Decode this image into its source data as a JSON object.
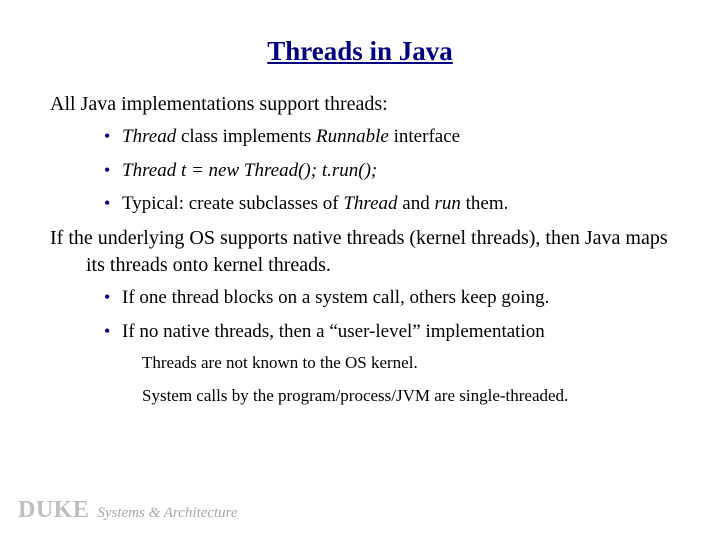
{
  "title": "Threads in Java",
  "para1": "All Java implementations support threads:",
  "bullets1": {
    "b0_pre": "Thread",
    "b0_mid": " class implements ",
    "b0_post": "Runnable",
    "b0_end": " interface",
    "b1": "Thread t = new Thread(); t.run();",
    "b2_pre": "Typical: create subclasses of ",
    "b2_mid": "Thread",
    "b2_mid2": " and ",
    "b2_post": "run",
    "b2_end": " them."
  },
  "para2": "If the underlying OS supports native threads (kernel threads), then Java maps its threads onto kernel threads.",
  "bullets2": {
    "b0": "If one thread blocks on a system call, others keep going.",
    "b1": "If no native threads, then a “user-level” implementation"
  },
  "sub": {
    "s0": "Threads are not known to the OS kernel.",
    "s1": "System calls by the program/process/JVM are single-threaded."
  },
  "footer": {
    "duke": "DUKE",
    "sub": "Systems & Architecture"
  }
}
